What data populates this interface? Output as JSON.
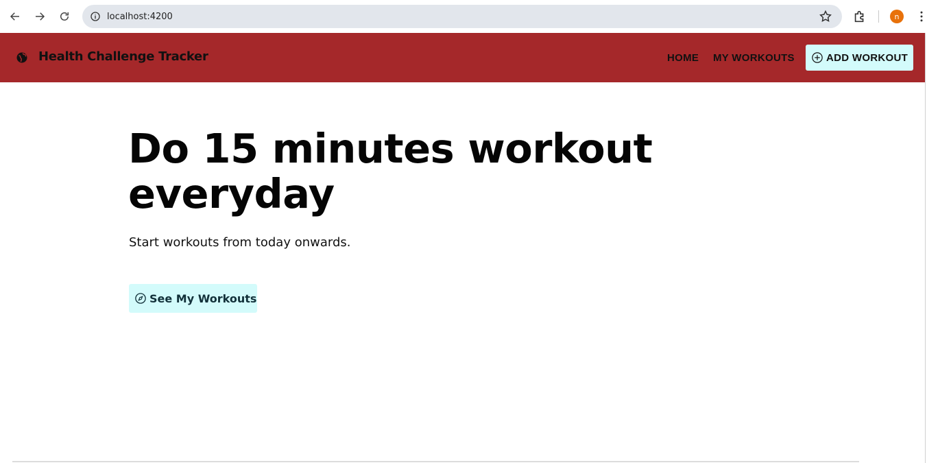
{
  "browser": {
    "url": "localhost:4200",
    "profile_initial": "n",
    "profile_color": "#e8710a",
    "icons": [
      "back-arrow-icon",
      "forward-arrow-icon",
      "reload-icon",
      "site-info-icon",
      "bookmark-star-icon",
      "extensions-icon",
      "kebab-menu-icon"
    ]
  },
  "header": {
    "brand": "Health Challenge Tracker",
    "brand_icon": "globe-icon",
    "nav": {
      "home": "HOME",
      "my_workouts": "MY WORKOUTS",
      "add_workout": "ADD WORKOUT"
    },
    "colors": {
      "background": "#a5282a",
      "button_bg": "#d3fbfb"
    }
  },
  "hero": {
    "title": "Do 15 minutes workout everyday",
    "subtitle": "Start workouts from today onwards.",
    "cta_label": "See My Workouts",
    "cta_icon": "compass-icon"
  }
}
